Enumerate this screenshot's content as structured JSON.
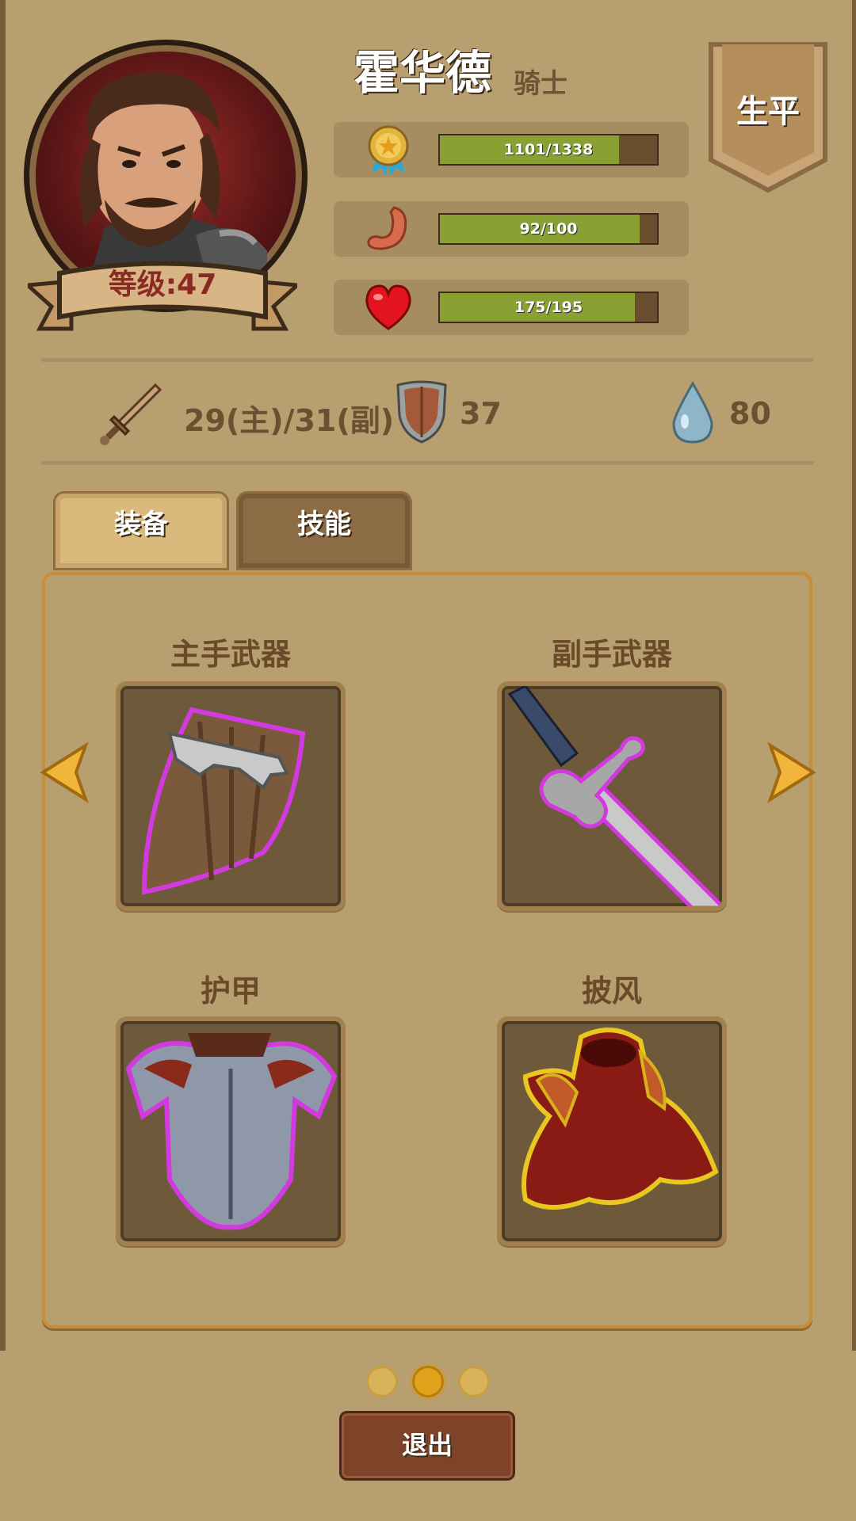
{
  "hero": {
    "name": "霍华德",
    "class": "骑士",
    "level_label": "等级:47"
  },
  "life_button": "生平",
  "stats": [
    {
      "icon": "medal-icon",
      "text": "1101/1338",
      "fraction": 0.823
    },
    {
      "icon": "stomach-icon",
      "text": "92/100",
      "fraction": 0.92
    },
    {
      "icon": "heart-icon",
      "text": "175/195",
      "fraction": 0.897
    }
  ],
  "attributes": {
    "attack": "29(主)/31(副)",
    "defense": "37",
    "water": "80"
  },
  "tabs": [
    "装备",
    "技能"
  ],
  "active_tab": "装备",
  "slots": [
    {
      "label": "主手武器",
      "item": "shield-icon"
    },
    {
      "label": "副手武器",
      "item": "sword-icon"
    },
    {
      "label": "护甲",
      "item": "armor-icon"
    },
    {
      "label": "披风",
      "item": "cape-icon"
    }
  ],
  "pagination": {
    "pages": 3,
    "current": 2
  },
  "exit_button": "退出",
  "colors": {
    "background": "#b79f6f",
    "bar_fill": "#8aa032",
    "exit_button": "#7e442a",
    "active_dot": "#e3a21b",
    "panel_border": "#c98d3a"
  }
}
